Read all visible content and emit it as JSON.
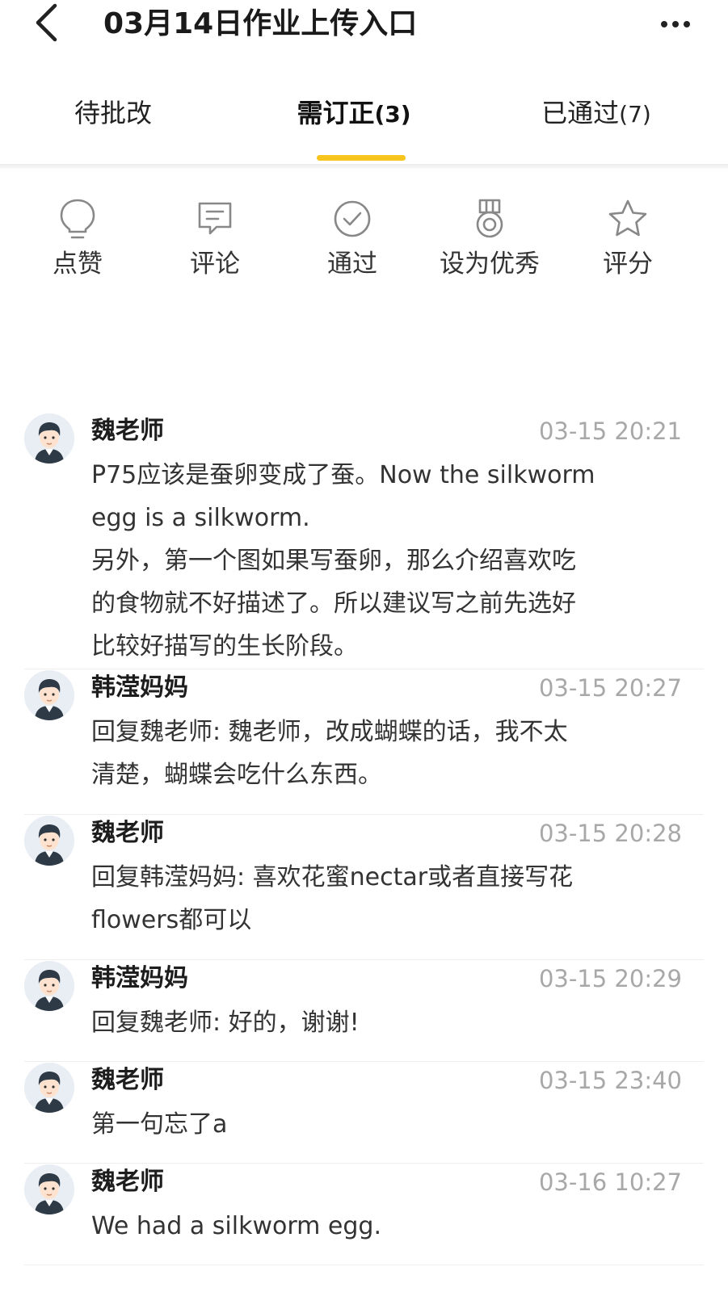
{
  "header": {
    "title": "03月14日作业上传入口"
  },
  "tabs": [
    {
      "label": "待批改",
      "count": ""
    },
    {
      "label": "需订正",
      "count": "(3)"
    },
    {
      "label": "已通过",
      "count": "(7)"
    }
  ],
  "active_tab": 1,
  "actions": [
    {
      "label": "点赞",
      "icon": "lightbulb-icon"
    },
    {
      "label": "评论",
      "icon": "comment-icon"
    },
    {
      "label": "通过",
      "icon": "check-circle-icon"
    },
    {
      "label": "设为优秀",
      "icon": "medal-icon"
    },
    {
      "label": "评分",
      "icon": "star-icon"
    }
  ],
  "comments": [
    {
      "name": "魏老师",
      "time": "03-15 20:21",
      "lines": [
        "P75应该是蚕卵变成了蚕。Now the silkworm",
        "egg is a silkworm.",
        "另外，第一个图如果写蚕卵，那么介绍喜欢吃",
        "的食物就不好描述了。所以建议写之前先选好",
        "比较好描写的生长阶段。"
      ]
    },
    {
      "name": "韩滢妈妈",
      "time": "03-15 20:27",
      "lines": [
        "回复魏老师: 魏老师，改成蝴蝶的话，我不太",
        "清楚，蝴蝶会吃什么东西。"
      ]
    },
    {
      "name": "魏老师",
      "time": "03-15 20:28",
      "lines": [
        "回复韩滢妈妈: 喜欢花蜜nectar或者直接写花",
        "flowers都可以"
      ]
    },
    {
      "name": "韩滢妈妈",
      "time": "03-15 20:29",
      "lines": [
        "回复魏老师: 好的，谢谢!"
      ]
    },
    {
      "name": "魏老师",
      "time": "03-15 23:40",
      "lines": [
        "第一句忘了a"
      ]
    },
    {
      "name": "魏老师",
      "time": "03-16 10:27",
      "lines": [
        "We had a silkworm egg."
      ]
    }
  ],
  "colors": {
    "accent": "#f7c51e",
    "timestamp": "#a8a8a8",
    "divider": "#eeeeee"
  }
}
